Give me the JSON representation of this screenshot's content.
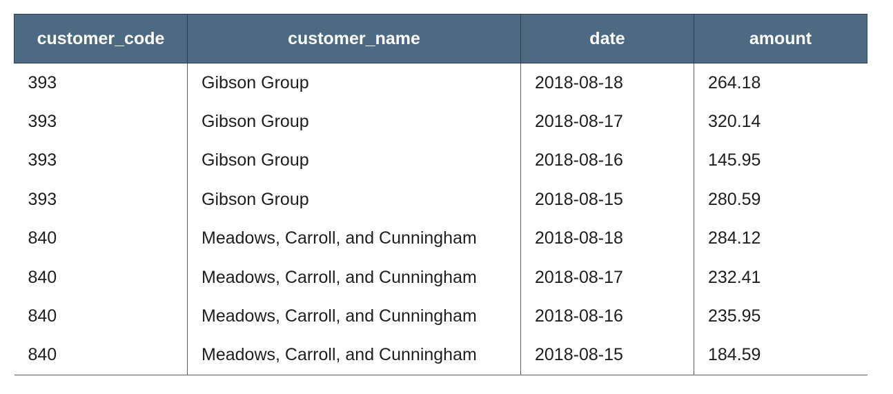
{
  "table": {
    "columns": [
      "customer_code",
      "customer_name",
      "date",
      "amount"
    ],
    "rows": [
      [
        "393",
        "Gibson Group",
        "2018-08-18",
        "264.18"
      ],
      [
        "393",
        "Gibson Group",
        "2018-08-17",
        "320.14"
      ],
      [
        "393",
        "Gibson Group",
        "2018-08-16",
        "145.95"
      ],
      [
        "393",
        "Gibson Group",
        "2018-08-15",
        "280.59"
      ],
      [
        "840",
        "Meadows, Carroll, and Cunningham",
        "2018-08-18",
        "284.12"
      ],
      [
        "840",
        "Meadows, Carroll, and Cunningham",
        "2018-08-17",
        "232.41"
      ],
      [
        "840",
        "Meadows, Carroll, and Cunningham",
        "2018-08-16",
        "235.95"
      ],
      [
        "840",
        "Meadows, Carroll, and Cunningham",
        "2018-08-15",
        "184.59"
      ]
    ]
  },
  "colors": {
    "header_background": "#4e6a83",
    "header_text": "#ffffff",
    "body_text": "#1e1e1e"
  }
}
